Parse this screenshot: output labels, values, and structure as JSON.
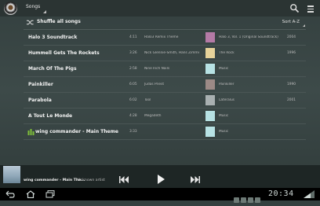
{
  "header": {
    "title": "Songs",
    "actions": [
      "search-icon",
      "menu-icon"
    ]
  },
  "shuffle": {
    "label": "Shuffle all songs",
    "sort_label": "Sort A-Z"
  },
  "songs": [
    {
      "title": "Halo 3  Soundtrack",
      "duration": "4:11",
      "artist": "Halo3 Remix Theme",
      "album": "Halo 3, Vol. 1 (Original Soundtrack)",
      "year": "2004",
      "cover_color": "#b47aa6"
    },
    {
      "title": "Hummell Gets The Rockets",
      "duration": "3:26",
      "artist": "Nick Glennie-Smith, Hans Zimmer",
      "album": "The Rock",
      "year": "1996",
      "cover_color": "#e6d29a"
    },
    {
      "title": "March Of The Pigs",
      "duration": "2:58",
      "artist": "Nine Inch Nails",
      "album": "Music",
      "year": "",
      "cover_color": "#b7e2e4"
    },
    {
      "title": "Painkiller",
      "duration": "6:05",
      "artist": "Judas Priest",
      "album": "Painkiller",
      "year": "1990",
      "cover_color": "#9c8a86"
    },
    {
      "title": "Parabola",
      "duration": "6:02",
      "artist": "Tool",
      "album": "Lateralus",
      "year": "2001",
      "cover_color": "#a9b0b1"
    },
    {
      "title": "A Tout Le Monde",
      "duration": "4:28",
      "artist": "Megadeth",
      "album": "Music",
      "year": "",
      "cover_color": "#b7e2e4"
    },
    {
      "title": "wing commander - Main Theme",
      "duration": "3:33",
      "artist": "",
      "album": "Music",
      "year": "",
      "cover_color": "#b7e2e4",
      "now_playing": true
    }
  ],
  "now_playing": {
    "title": "wing commander - Main The...",
    "artist": "Unknown artist"
  },
  "system": {
    "clock": "20:34"
  }
}
